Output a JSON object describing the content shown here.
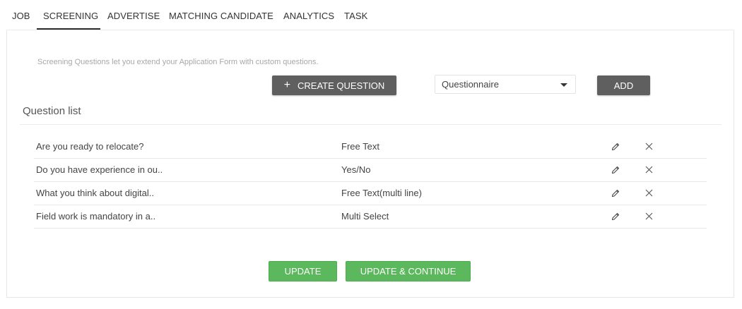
{
  "tabs": [
    {
      "label": "JOB"
    },
    {
      "label": "SCREENING"
    },
    {
      "label": "ADVERTISE"
    },
    {
      "label": "MATCHING CANDIDATE"
    },
    {
      "label": "ANALYTICS"
    },
    {
      "label": "TASK"
    }
  ],
  "active_tab": "SCREENING",
  "screening": {
    "hint": "Screening Questions let you extend your Application Form with custom questions.",
    "create_button": {
      "icon": "plus-icon",
      "label": "CREATE QUESTION"
    },
    "questionnaire_select": {
      "value": "Questionnaire",
      "icon": "caret-down-icon"
    },
    "add_button": "ADD",
    "list_title": "Question list",
    "questions": [
      {
        "question": "Are you ready to relocate?",
        "type": "Free Text"
      },
      {
        "question": "Do you have experience in ou..",
        "type": "Yes/No"
      },
      {
        "question": "What you think about digital..",
        "type": "Free Text(multi line)"
      },
      {
        "question": "Field work is mandatory in a..",
        "type": "Multi Select"
      }
    ],
    "row_icons": {
      "edit": "pencil-icon",
      "delete": "close-icon"
    },
    "update_button": "UPDATE",
    "update_continue_button": "UPDATE & CONTINUE"
  },
  "colors": {
    "dark_button": "#5f5f5f",
    "green_button": "#5cb85c",
    "active_tab_underline": "#2b2b2b"
  }
}
